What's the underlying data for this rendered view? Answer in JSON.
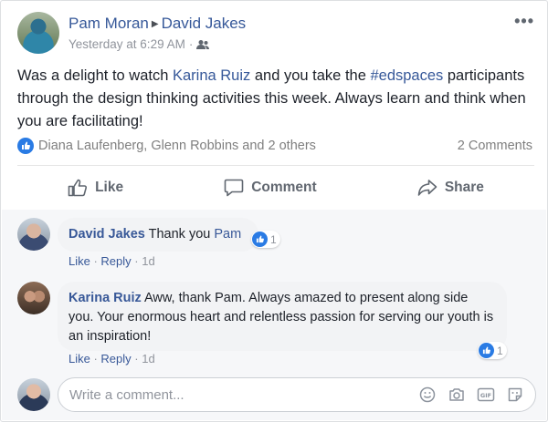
{
  "post": {
    "author": "Pam Moran",
    "target": "David Jakes",
    "timestamp": "Yesterday at 6:29 AM",
    "text_parts": {
      "p1": "Was a delight to watch ",
      "mention": "Karina Ruiz",
      "p2": " and you take the ",
      "hashtag": "#edspaces",
      "p3": " participants through the design thinking activities this week. Always learn and think when you are facilitating!"
    },
    "reactions_summary": "Diana Laufenberg, Glenn Robbins and 2 others",
    "comments_count": "2 Comments"
  },
  "actions": {
    "like": "Like",
    "comment": "Comment",
    "share": "Share"
  },
  "comments": [
    {
      "author": "David Jakes",
      "text": "Thank you ",
      "mention": "Pam",
      "like_link": "Like",
      "reply_link": "Reply",
      "time": "1d",
      "reaction_count": "1"
    },
    {
      "author": "Karina Ruiz",
      "text": "Aww, thank Pam. Always amazed to present along side you. Your enormous heart and relentless passion for serving our youth is an inspiration!",
      "like_link": "Like",
      "reply_link": "Reply",
      "time": "1d",
      "reaction_count": "1"
    }
  ],
  "composer": {
    "placeholder": "Write a comment..."
  },
  "colors": {
    "link": "#365899",
    "like_blue": "#2a7be4",
    "muted": "#90949c"
  }
}
